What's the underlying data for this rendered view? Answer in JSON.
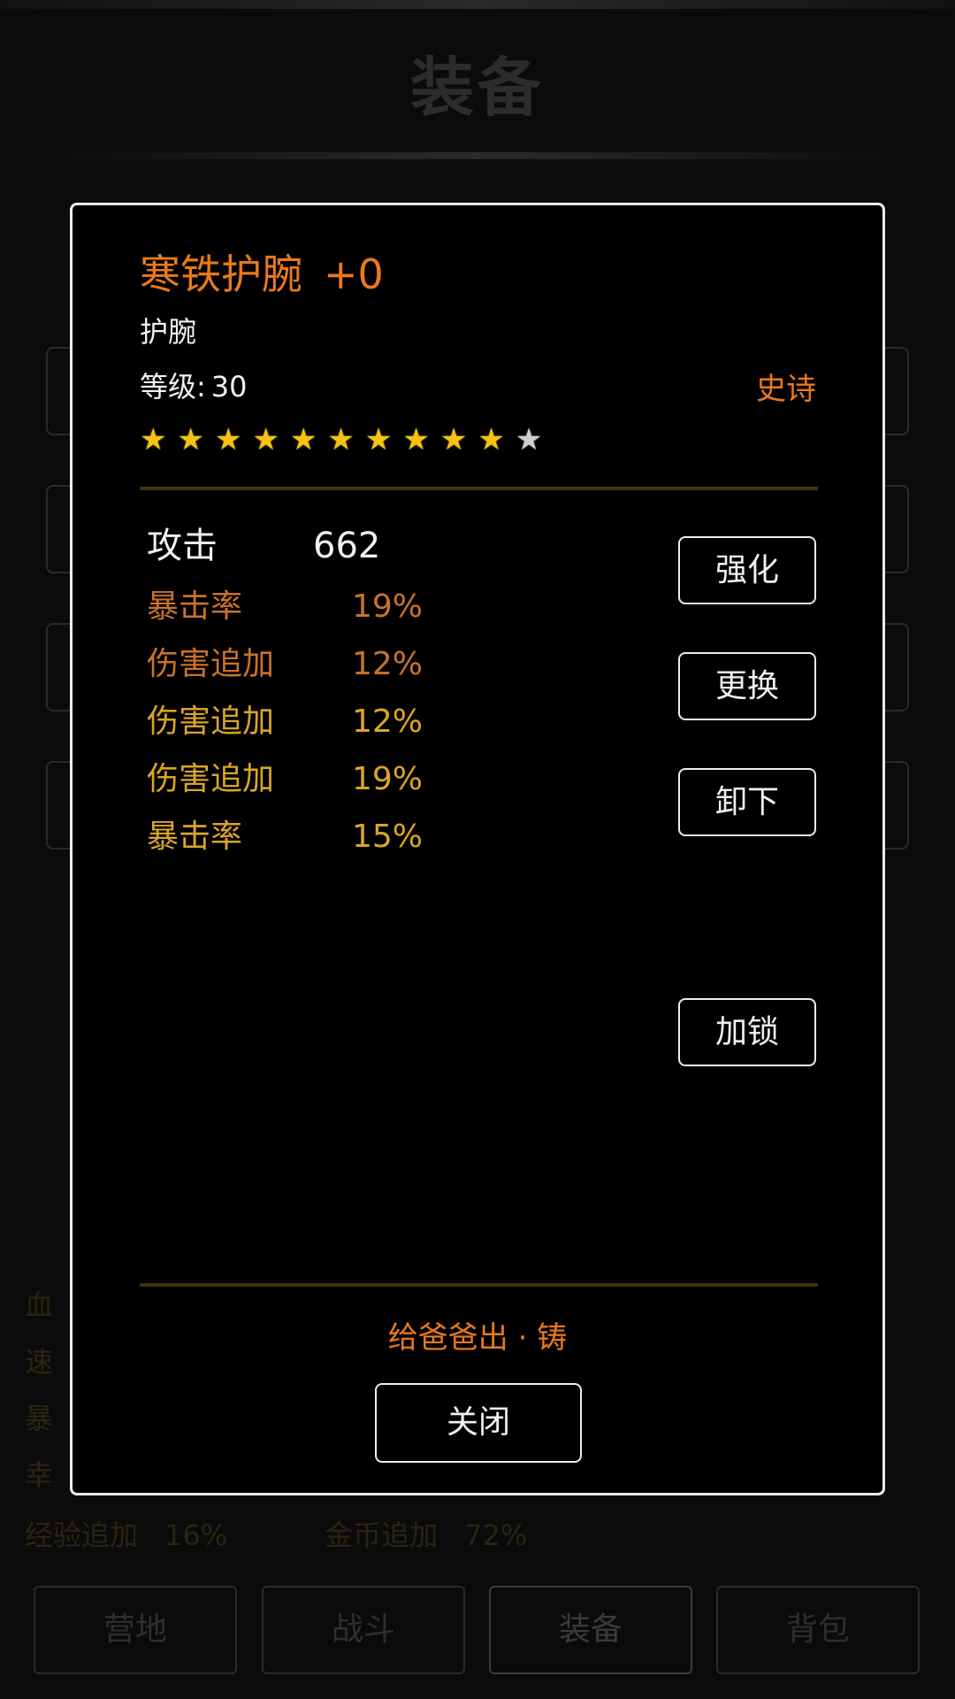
{
  "background": {
    "title": "装备",
    "stats_visible_line": {
      "exp_label": "经验追加",
      "exp_value": "16%",
      "gold_label": "金币追加",
      "gold_value": "72%"
    },
    "stats_partial": [
      "血",
      "速",
      "暴",
      "幸"
    ],
    "nav": [
      {
        "label": "营地",
        "active": false
      },
      {
        "label": "战斗",
        "active": false
      },
      {
        "label": "装备",
        "active": true
      },
      {
        "label": "背包",
        "active": false
      }
    ]
  },
  "item": {
    "name": "寒铁护腕",
    "enhance": "+0",
    "type": "护腕",
    "level_label": "等级:",
    "level": "30",
    "rarity": "史诗",
    "stars_filled": 10,
    "stars_total": 11,
    "main_stat": {
      "label": "攻击",
      "value": "662"
    },
    "sub_stats": [
      {
        "label": "暴击率",
        "value": "19%",
        "color": "#c8732a"
      },
      {
        "label": "伤害追加",
        "value": "12%",
        "color": "#c8732a"
      },
      {
        "label": "伤害追加",
        "value": "12%",
        "color": "#d9a52a"
      },
      {
        "label": "伤害追加",
        "value": "19%",
        "color": "#d9a52a"
      },
      {
        "label": "暴击率",
        "value": "15%",
        "color": "#d9a52a"
      }
    ],
    "crafter": "给爸爸出 · 铸"
  },
  "actions": {
    "enhance": "强化",
    "replace": "更换",
    "unequip": "卸下",
    "lock": "加锁",
    "close": "关闭"
  },
  "colors": {
    "accent_orange": "#e8791c",
    "gold": "#d9a52a",
    "divider": "#3d3410"
  }
}
